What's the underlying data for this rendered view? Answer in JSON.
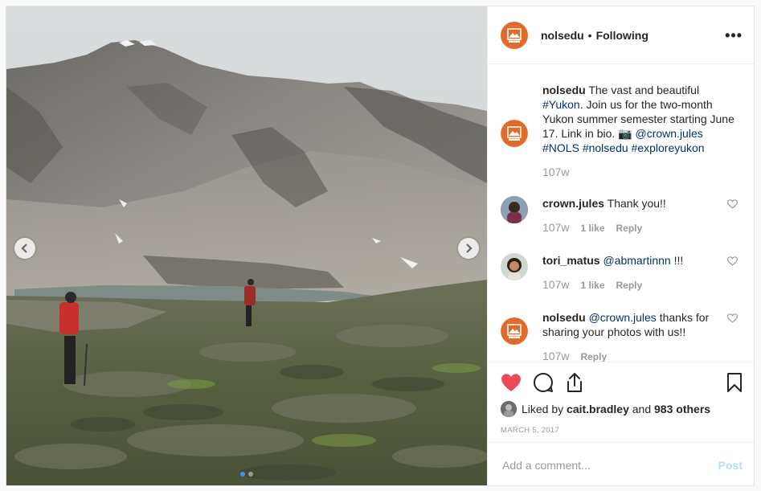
{
  "header": {
    "username": "nolsedu",
    "separator": "•",
    "follow_status": "Following",
    "more_label": "•••"
  },
  "caption": {
    "username": "nolsedu",
    "text_1": "The vast and beautiful",
    "tag_yukon": "#Yukon",
    "text_2": ". Join us for the two-month Yukon summer semester starting June 17. Link in bio. 📷",
    "mention": "@crown.jules",
    "tags": [
      "#NOLS",
      "#nolsedu",
      "#exploreyukon"
    ],
    "time": "107w"
  },
  "comments": [
    {
      "username": "crown.jules",
      "text": "Thank you!!",
      "time": "107w",
      "likes": "1 like",
      "reply": "Reply"
    },
    {
      "username": "tori_matus",
      "mention": "@abmartinnn",
      "text": " !!!",
      "time": "107w",
      "likes": "1 like",
      "reply": "Reply"
    },
    {
      "username": "nolsedu",
      "mention": "@crown.jules",
      "text": " thanks for sharing your photos with us!!",
      "time": "107w",
      "reply": "Reply"
    }
  ],
  "likes": {
    "prefix": "Liked by",
    "user": "cait.bradley",
    "middle": "and",
    "others": "983 others"
  },
  "date": "MARCH 5, 2017",
  "add_comment": {
    "placeholder": "Add a comment...",
    "post_label": "Post"
  },
  "colors": {
    "brand": "#e06b2b",
    "like_red": "#ed4956",
    "link": "#003569",
    "post_disabled": "#b2dffc",
    "dot_active": "#3897f0"
  },
  "carousel": {
    "slides": 2,
    "active": 1
  }
}
